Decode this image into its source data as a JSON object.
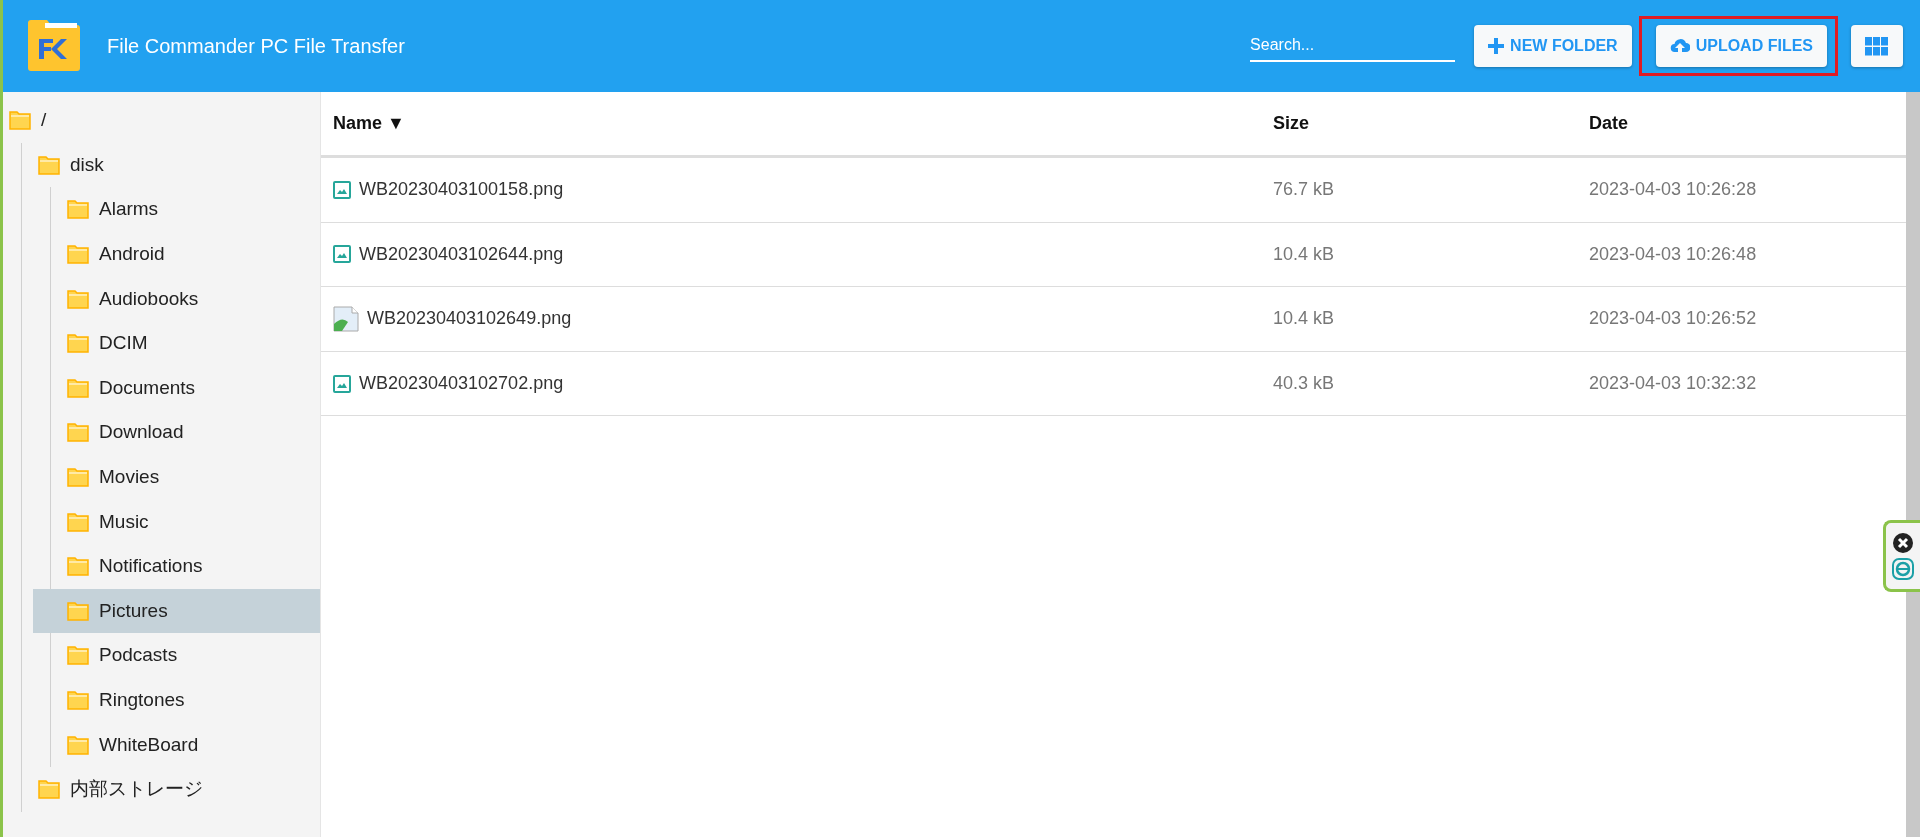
{
  "header": {
    "title": "File Commander PC File Transfer",
    "search": {
      "placeholder": "Search..."
    },
    "buttons": [
      {
        "kind": "new-folder",
        "label": "NEW FOLDER",
        "highlighted": false
      },
      {
        "kind": "upload",
        "label": "UPLOAD FILES",
        "highlighted": true
      },
      {
        "kind": "grid",
        "highlighted": false
      }
    ]
  },
  "sidebar": {
    "tree": [
      {
        "label": "/",
        "selected": false,
        "children": [
          {
            "label": "disk",
            "selected": false,
            "children": [
              {
                "label": "Alarms",
                "selected": false
              },
              {
                "label": "Android",
                "selected": false
              },
              {
                "label": "Audiobooks",
                "selected": false
              },
              {
                "label": "DCIM",
                "selected": false
              },
              {
                "label": "Documents",
                "selected": false
              },
              {
                "label": "Download",
                "selected": false
              },
              {
                "label": "Movies",
                "selected": false
              },
              {
                "label": "Music",
                "selected": false
              },
              {
                "label": "Notifications",
                "selected": false
              },
              {
                "label": "Pictures",
                "selected": true
              },
              {
                "label": "Podcasts",
                "selected": false
              },
              {
                "label": "Ringtones",
                "selected": false
              },
              {
                "label": "WhiteBoard",
                "selected": false
              }
            ]
          },
          {
            "label": "内部ストレージ",
            "selected": false
          }
        ]
      }
    ]
  },
  "table": {
    "columns": [
      {
        "label": "Name ▼"
      },
      {
        "label": "Size"
      },
      {
        "label": "Date"
      }
    ],
    "rows": [
      {
        "kind": "image",
        "name": "WB20230403100158.png",
        "size": "76.7 kB",
        "date": "2023-04-03 10:26:28"
      },
      {
        "kind": "image",
        "name": "WB20230403102644.png",
        "size": "10.4 kB",
        "date": "2023-04-03 10:26:48"
      },
      {
        "kind": "broken",
        "name": "WB20230403102649.png",
        "size": "10.4 kB",
        "date": "2023-04-03 10:26:52"
      },
      {
        "kind": "image",
        "name": "WB20230403102702.png",
        "size": "40.3 kB",
        "date": "2023-04-03 10:32:32"
      }
    ]
  }
}
